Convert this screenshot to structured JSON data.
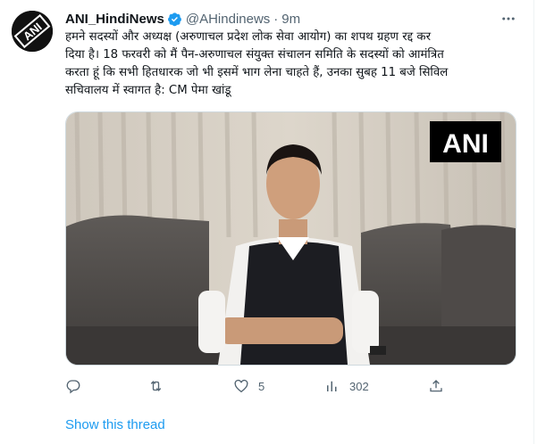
{
  "author": {
    "display_name": "ANI_HindiNews",
    "handle": "@AHindinews",
    "separator": "·",
    "time_ago": "9m",
    "verified_color": "#1d9bf0",
    "avatar_logo_text": "ANI",
    "avatar_icon": "ani-logo"
  },
  "tweet": {
    "text_lines": [
      "हमने सदस्यों और अध्यक्ष (अरुणाचल प्रदेश लोक सेवा आयोग) का शपथ ग्रहण रद्द कर",
      "दिया है। 18 फरवरी को मैं पैन-अरुणाचल संयुक्त संचालन समिति के सदस्यों को आमंत्रित",
      "करता हूं कि सभी हितधारक जो भी इसमें भाग लेना चाहते हैं, उनका सुबह 11 बजे सिविल",
      "सचिवालय में स्वागत है: CM पेमा खांडू"
    ]
  },
  "media": {
    "watermark": "ANI",
    "description_icon": "video-still"
  },
  "actions": {
    "reply": {
      "icon": "reply-icon",
      "count": ""
    },
    "retweet": {
      "icon": "retweet-icon",
      "count": ""
    },
    "like": {
      "icon": "heart-icon",
      "count": "5"
    },
    "views": {
      "icon": "views-icon",
      "count": "302"
    },
    "share": {
      "icon": "share-icon",
      "count": ""
    }
  },
  "thread_link": "Show this thread",
  "colors": {
    "accent": "#1d9bf0",
    "secondary_text": "#536471",
    "primary_text": "#0f1419"
  }
}
